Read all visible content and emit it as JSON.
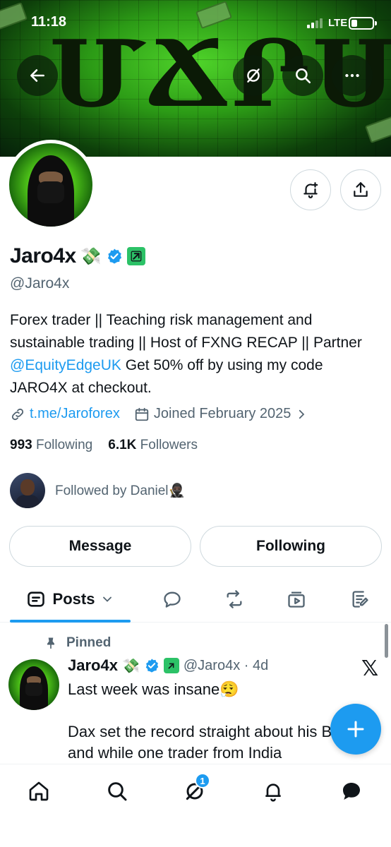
{
  "status_bar": {
    "time": "11:18",
    "network": "LTE"
  },
  "banner": {
    "text": "ՄՃՐՍ"
  },
  "profile": {
    "display_name": "Jaro4x",
    "name_emoji": "💸",
    "handle": "@Jaro4x",
    "bio_part1": "Forex trader || Teaching risk management and sustainable trading || Host of FXNG RECAP || Partner ",
    "bio_mention": "@EquityEdgeUK",
    "bio_part2": " Get 50% off by using my code JARO4X at checkout.",
    "link": "t.me/Jaroforex",
    "joined": "Joined February 2025",
    "following_count": "993",
    "following_label": "Following",
    "followers_count": "6.1K",
    "followers_label": "Followers",
    "followed_by": "Followed by Daniel🥷🏿"
  },
  "buttons": {
    "message": "Message",
    "following": "Following"
  },
  "tabs": {
    "active": "Posts"
  },
  "post": {
    "pinned_label": "Pinned",
    "author": "Jaro4x",
    "author_emoji": "💸",
    "handle_time": "@Jaro4x · 4d",
    "text": "Last week was insane😮‍💨\n\nDax set the record straight about his Brabus, and while one trader from India"
  },
  "nav": {
    "notification_badge": "1"
  },
  "colors": {
    "accent": "#1d9bf0",
    "verified": "#1d9bf0",
    "business_badge": "#2cc267",
    "text_secondary": "#536471"
  }
}
